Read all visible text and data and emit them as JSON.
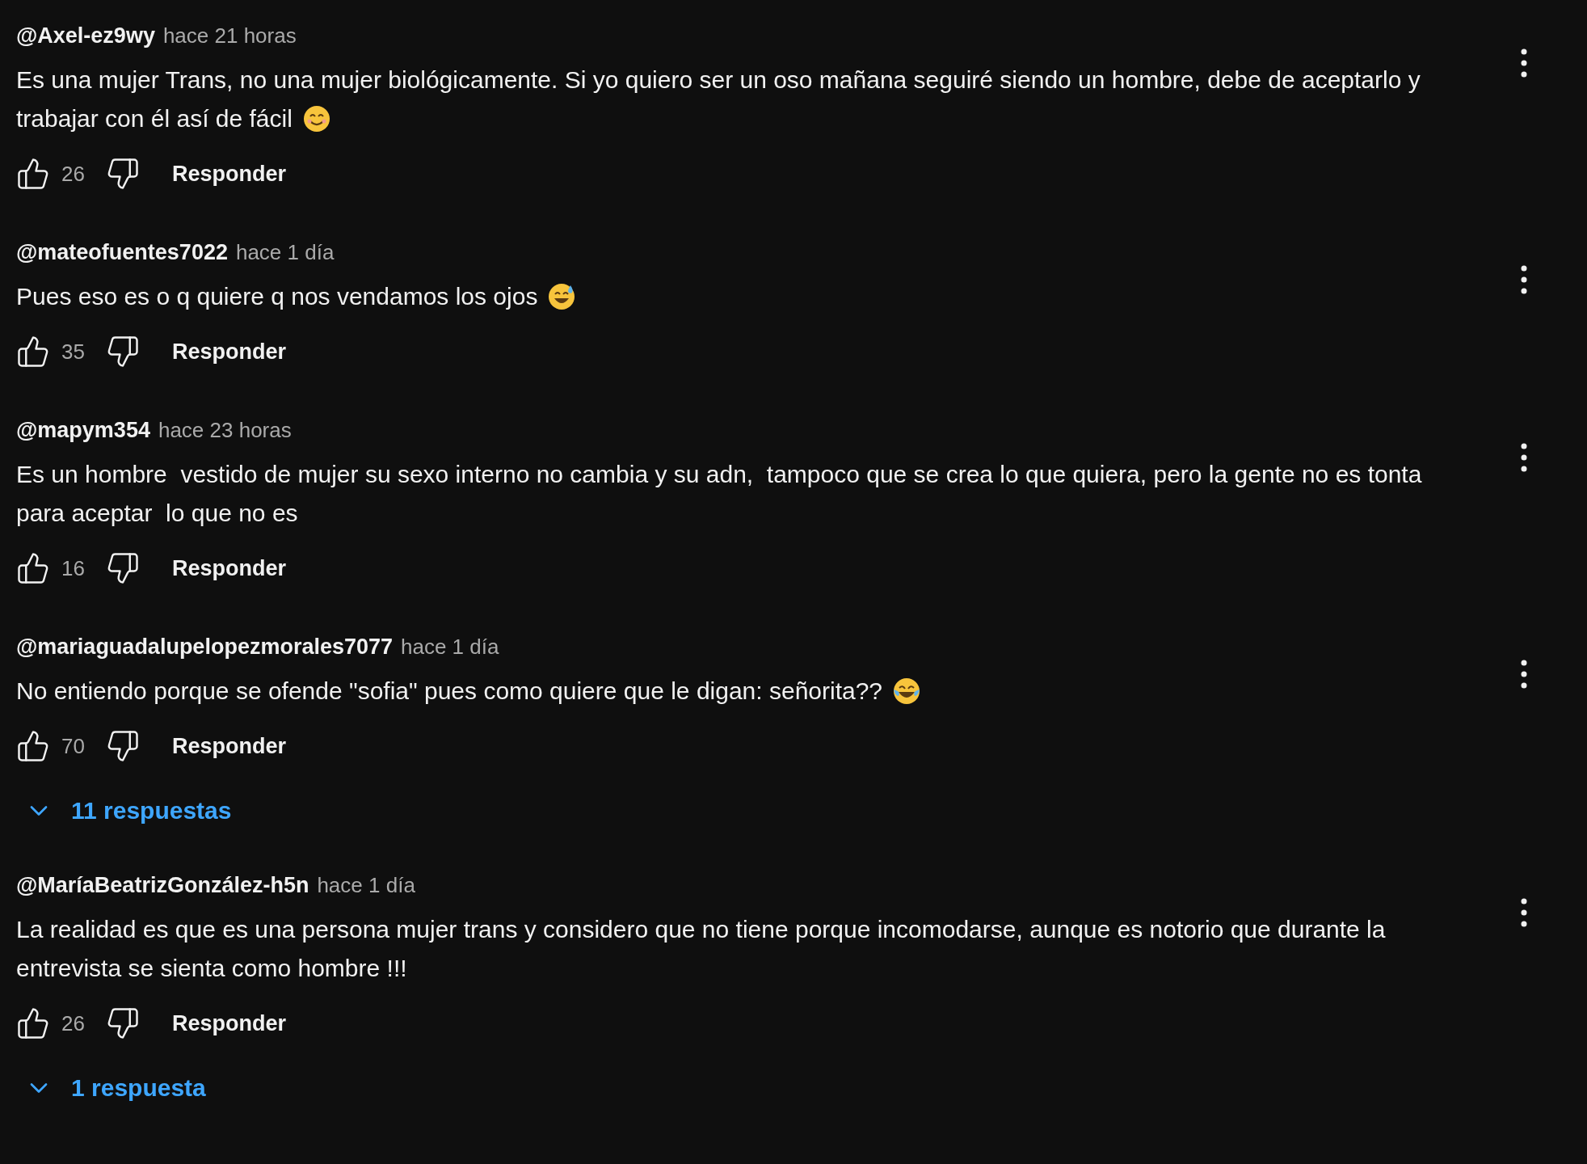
{
  "comments": [
    {
      "author": "@Axel-ez9wy",
      "time": "hace 21 horas",
      "text": "Es una mujer Trans, no una mujer biológicamente. Si yo quiero ser un oso mañana seguiré siendo un hombre, debe de aceptarlo y trabajar con él así de fácil",
      "emoji": {
        "kind": "smile"
      },
      "likes": "26",
      "reply_label": "Responder"
    },
    {
      "author": "@mateofuentes7022",
      "time": "hace 1 día",
      "text": "Pues eso es o q quiere q nos vendamos los ojos",
      "emoji": {
        "kind": "sweat"
      },
      "likes": "35",
      "reply_label": "Responder"
    },
    {
      "author": "@mapym354",
      "time": "hace 23 horas",
      "text": "Es un hombre  vestido de mujer su sexo interno no cambia y su adn,  tampoco que se crea lo que quiera, pero la gente no es tonta para aceptar  lo que no es",
      "likes": "16",
      "reply_label": "Responder"
    },
    {
      "author": "@mariaguadalupelopezmorales7077",
      "time": "hace 1 día",
      "text": "No entiendo porque se ofende \"sofia\" pues como quiere que le digan: señorita??",
      "emoji": {
        "kind": "laugh"
      },
      "likes": "70",
      "reply_label": "Responder",
      "replies": "11 respuestas"
    },
    {
      "author": "@MaríaBeatrizGonzález-h5n",
      "time": "hace 1 día",
      "text": "La realidad es que es una persona mujer trans y considero que no tiene porque incomodarse, aunque es notorio que durante la entrevista se sienta como hombre !!!",
      "likes": "26",
      "reply_label": "Responder",
      "replies": "1 respuesta"
    }
  ]
}
